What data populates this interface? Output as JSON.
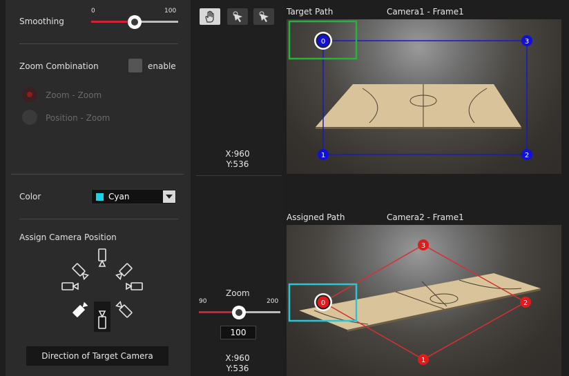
{
  "smoothing": {
    "label": "Smoothing",
    "min_label": "0",
    "max_label": "100",
    "value": 0.42
  },
  "zoom_combination": {
    "label": "Zoom Combination",
    "enable_label": "enable",
    "enabled": false,
    "options": [
      {
        "label": "Zoom - Zoom",
        "selected": true
      },
      {
        "label": "Position - Zoom",
        "selected": false
      }
    ]
  },
  "color": {
    "label": "Color",
    "selected": "Cyan",
    "swatch": "#19d3e4"
  },
  "assign_camera": {
    "label": "Assign Camera Position",
    "tooltip": "Direction of Target Camera"
  },
  "toolbar": {
    "tools": [
      "hand-icon",
      "target-cursor-icon",
      "target-cursor-alt-icon"
    ]
  },
  "target_view": {
    "title": "Target Path",
    "camera": "Camera1 - Frame1",
    "coord_x": "X:960",
    "coord_y": "Y:536",
    "points": [
      "0",
      "1",
      "2",
      "3"
    ],
    "point_color": "#1010d8",
    "highlight_color": "#27b23a"
  },
  "assigned_view": {
    "title": "Assigned Path",
    "camera": "Camera2 - Frame1",
    "coord_x": "X:960",
    "coord_y": "Y:536",
    "points": [
      "0",
      "1",
      "2",
      "3"
    ],
    "point_color": "#e01b1b",
    "highlight_color": "#2fc5d0"
  },
  "zoom": {
    "label": "Zoom",
    "min_label": "90",
    "max_label": "200",
    "value": 100,
    "display": "100"
  }
}
